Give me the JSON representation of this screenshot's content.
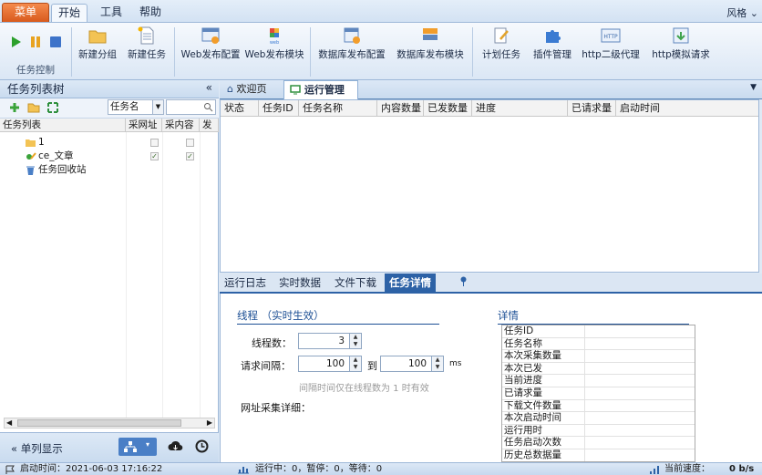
{
  "menubar": {
    "menu_label": "菜单",
    "tabs": [
      "开始",
      "工具",
      "帮助"
    ],
    "style_label": "风格 ⌄"
  },
  "ribbon": {
    "group_caption": "任务控制",
    "buttons": [
      "新建分组",
      "新建任务",
      "Web发布配置",
      "Web发布模块",
      "数据库发布配置",
      "数据库发布模块",
      "计划任务",
      "插件管理",
      "http二级代理",
      "http模拟请求"
    ]
  },
  "left": {
    "title": "任务列表树",
    "collapse": "«",
    "filter_select": "任务名",
    "cols": [
      "任务列表",
      "采网址",
      "采内容",
      "发"
    ],
    "rows": [
      {
        "name": "1",
        "c1": false,
        "c2": false
      },
      {
        "name": "ce_文章",
        "c1": true,
        "c2": true
      },
      {
        "name": "任务回收站"
      }
    ],
    "bottom_label": "« 单列显示"
  },
  "tabs": {
    "welcome": "欢迎页",
    "run": "运行管理"
  },
  "grid_cols": [
    "状态",
    "任务ID",
    "任务名称",
    "内容数量",
    "已发数量",
    "进度",
    "已请求量",
    "启动时间"
  ],
  "subtabs": [
    "运行日志",
    "实时数据",
    "文件下载",
    "任务详情"
  ],
  "detail": {
    "thread_title": "线程 （实时生效）",
    "threads_label": "线程数：",
    "threads_value": "3",
    "interval_label": "请求间隔：",
    "interval_from": "100",
    "to_label": "到",
    "interval_to": "100",
    "unit": "ms",
    "hint": "间隔时间仅在线程数为 1 时有效",
    "url_detail": "网址采集详细：",
    "info_title": "详情",
    "info_rows": [
      "任务ID",
      "任务名称",
      "本次采集数量",
      "本次已发",
      "当前进度",
      "已请求量",
      "下载文件数量",
      "本次启动时间",
      "运行用时",
      "任务启动次数",
      "历史总数据量"
    ]
  },
  "status": {
    "start_time": "启动时间：2021-06-03 17:16:22",
    "counts": "运行中：0，暂停：0，等待：0",
    "speed_label": "当前速度：",
    "speed_value": "0 b/s"
  },
  "colors": {
    "accent": "#2d62a6",
    "menu": "#e8743a"
  }
}
